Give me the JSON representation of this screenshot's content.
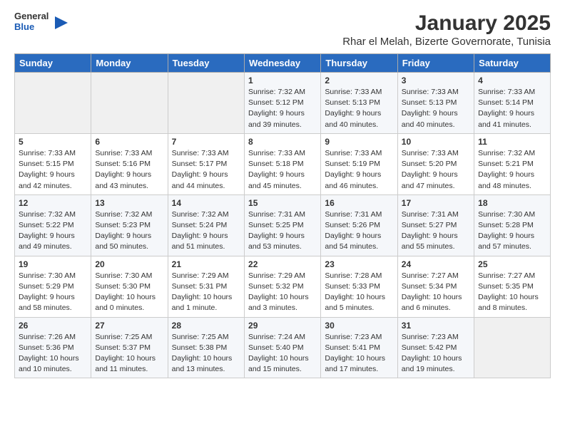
{
  "logo": {
    "general": "General",
    "blue": "Blue"
  },
  "title": "January 2025",
  "subtitle": "Rhar el Melah, Bizerte Governorate, Tunisia",
  "days_header": [
    "Sunday",
    "Monday",
    "Tuesday",
    "Wednesday",
    "Thursday",
    "Friday",
    "Saturday"
  ],
  "weeks": [
    [
      {
        "day": "",
        "sunrise": "",
        "sunset": "",
        "daylight": ""
      },
      {
        "day": "",
        "sunrise": "",
        "sunset": "",
        "daylight": ""
      },
      {
        "day": "",
        "sunrise": "",
        "sunset": "",
        "daylight": ""
      },
      {
        "day": "1",
        "sunrise": "Sunrise: 7:32 AM",
        "sunset": "Sunset: 5:12 PM",
        "daylight": "Daylight: 9 hours and 39 minutes."
      },
      {
        "day": "2",
        "sunrise": "Sunrise: 7:33 AM",
        "sunset": "Sunset: 5:13 PM",
        "daylight": "Daylight: 9 hours and 40 minutes."
      },
      {
        "day": "3",
        "sunrise": "Sunrise: 7:33 AM",
        "sunset": "Sunset: 5:13 PM",
        "daylight": "Daylight: 9 hours and 40 minutes."
      },
      {
        "day": "4",
        "sunrise": "Sunrise: 7:33 AM",
        "sunset": "Sunset: 5:14 PM",
        "daylight": "Daylight: 9 hours and 41 minutes."
      }
    ],
    [
      {
        "day": "5",
        "sunrise": "Sunrise: 7:33 AM",
        "sunset": "Sunset: 5:15 PM",
        "daylight": "Daylight: 9 hours and 42 minutes."
      },
      {
        "day": "6",
        "sunrise": "Sunrise: 7:33 AM",
        "sunset": "Sunset: 5:16 PM",
        "daylight": "Daylight: 9 hours and 43 minutes."
      },
      {
        "day": "7",
        "sunrise": "Sunrise: 7:33 AM",
        "sunset": "Sunset: 5:17 PM",
        "daylight": "Daylight: 9 hours and 44 minutes."
      },
      {
        "day": "8",
        "sunrise": "Sunrise: 7:33 AM",
        "sunset": "Sunset: 5:18 PM",
        "daylight": "Daylight: 9 hours and 45 minutes."
      },
      {
        "day": "9",
        "sunrise": "Sunrise: 7:33 AM",
        "sunset": "Sunset: 5:19 PM",
        "daylight": "Daylight: 9 hours and 46 minutes."
      },
      {
        "day": "10",
        "sunrise": "Sunrise: 7:33 AM",
        "sunset": "Sunset: 5:20 PM",
        "daylight": "Daylight: 9 hours and 47 minutes."
      },
      {
        "day": "11",
        "sunrise": "Sunrise: 7:32 AM",
        "sunset": "Sunset: 5:21 PM",
        "daylight": "Daylight: 9 hours and 48 minutes."
      }
    ],
    [
      {
        "day": "12",
        "sunrise": "Sunrise: 7:32 AM",
        "sunset": "Sunset: 5:22 PM",
        "daylight": "Daylight: 9 hours and 49 minutes."
      },
      {
        "day": "13",
        "sunrise": "Sunrise: 7:32 AM",
        "sunset": "Sunset: 5:23 PM",
        "daylight": "Daylight: 9 hours and 50 minutes."
      },
      {
        "day": "14",
        "sunrise": "Sunrise: 7:32 AM",
        "sunset": "Sunset: 5:24 PM",
        "daylight": "Daylight: 9 hours and 51 minutes."
      },
      {
        "day": "15",
        "sunrise": "Sunrise: 7:31 AM",
        "sunset": "Sunset: 5:25 PM",
        "daylight": "Daylight: 9 hours and 53 minutes."
      },
      {
        "day": "16",
        "sunrise": "Sunrise: 7:31 AM",
        "sunset": "Sunset: 5:26 PM",
        "daylight": "Daylight: 9 hours and 54 minutes."
      },
      {
        "day": "17",
        "sunrise": "Sunrise: 7:31 AM",
        "sunset": "Sunset: 5:27 PM",
        "daylight": "Daylight: 9 hours and 55 minutes."
      },
      {
        "day": "18",
        "sunrise": "Sunrise: 7:30 AM",
        "sunset": "Sunset: 5:28 PM",
        "daylight": "Daylight: 9 hours and 57 minutes."
      }
    ],
    [
      {
        "day": "19",
        "sunrise": "Sunrise: 7:30 AM",
        "sunset": "Sunset: 5:29 PM",
        "daylight": "Daylight: 9 hours and 58 minutes."
      },
      {
        "day": "20",
        "sunrise": "Sunrise: 7:30 AM",
        "sunset": "Sunset: 5:30 PM",
        "daylight": "Daylight: 10 hours and 0 minutes."
      },
      {
        "day": "21",
        "sunrise": "Sunrise: 7:29 AM",
        "sunset": "Sunset: 5:31 PM",
        "daylight": "Daylight: 10 hours and 1 minute."
      },
      {
        "day": "22",
        "sunrise": "Sunrise: 7:29 AM",
        "sunset": "Sunset: 5:32 PM",
        "daylight": "Daylight: 10 hours and 3 minutes."
      },
      {
        "day": "23",
        "sunrise": "Sunrise: 7:28 AM",
        "sunset": "Sunset: 5:33 PM",
        "daylight": "Daylight: 10 hours and 5 minutes."
      },
      {
        "day": "24",
        "sunrise": "Sunrise: 7:27 AM",
        "sunset": "Sunset: 5:34 PM",
        "daylight": "Daylight: 10 hours and 6 minutes."
      },
      {
        "day": "25",
        "sunrise": "Sunrise: 7:27 AM",
        "sunset": "Sunset: 5:35 PM",
        "daylight": "Daylight: 10 hours and 8 minutes."
      }
    ],
    [
      {
        "day": "26",
        "sunrise": "Sunrise: 7:26 AM",
        "sunset": "Sunset: 5:36 PM",
        "daylight": "Daylight: 10 hours and 10 minutes."
      },
      {
        "day": "27",
        "sunrise": "Sunrise: 7:25 AM",
        "sunset": "Sunset: 5:37 PM",
        "daylight": "Daylight: 10 hours and 11 minutes."
      },
      {
        "day": "28",
        "sunrise": "Sunrise: 7:25 AM",
        "sunset": "Sunset: 5:38 PM",
        "daylight": "Daylight: 10 hours and 13 minutes."
      },
      {
        "day": "29",
        "sunrise": "Sunrise: 7:24 AM",
        "sunset": "Sunset: 5:40 PM",
        "daylight": "Daylight: 10 hours and 15 minutes."
      },
      {
        "day": "30",
        "sunrise": "Sunrise: 7:23 AM",
        "sunset": "Sunset: 5:41 PM",
        "daylight": "Daylight: 10 hours and 17 minutes."
      },
      {
        "day": "31",
        "sunrise": "Sunrise: 7:23 AM",
        "sunset": "Sunset: 5:42 PM",
        "daylight": "Daylight: 10 hours and 19 minutes."
      },
      {
        "day": "",
        "sunrise": "",
        "sunset": "",
        "daylight": ""
      }
    ]
  ]
}
